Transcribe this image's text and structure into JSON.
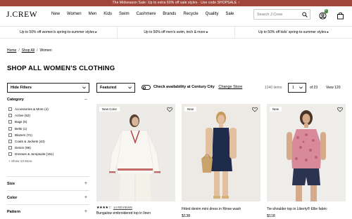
{
  "promo": {
    "text": "The Midseason Sale: Up to extra 60% off sale styles · Use code SHOPSALE",
    "arrow": "↑"
  },
  "brand": {
    "logo": "J.CREW"
  },
  "nav": {
    "links": [
      "New",
      "Women",
      "Men",
      "Kids",
      "Swim",
      "Cashmere",
      "Brands",
      "Recycle",
      "Quality",
      "Sale"
    ],
    "search_placeholder": "Search J.Crew",
    "account_badge_count": "0"
  },
  "benefits": [
    "Up to 50% off women's spring-to-summer styles ▸",
    "Up to 50% off men's swim, tech & more ▸",
    "Up to 50% off kids' spring-to-summer styles ▸"
  ],
  "breadcrumb": {
    "home": "Home",
    "shop_all": "Shop All",
    "current": "Women",
    "separator": "/"
  },
  "page_title": "SHOP ALL WOMEN'S CLOTHING",
  "toolbar": {
    "hide_filters": "Hide Filters",
    "sort_label": "Featured",
    "availability_prefix": "Check availability at ",
    "store_name": "Century City",
    "change_store": "Change Store",
    "item_count": "1340 items",
    "current_page": "1",
    "page_of": "of 23",
    "view_label": "View 120"
  },
  "filters": {
    "category_title": "Category",
    "categories": [
      "Accessories & More (4)",
      "Active (52)",
      "Bags (5)",
      "Belts (1)",
      "Blazers (71)",
      "Coats & Jackets (43)",
      "Denim (98)",
      "Dresses & Jumpsuits (151)"
    ],
    "show_more": "+ Show 13 More",
    "sections": [
      "Size",
      "Color",
      "Pattern"
    ],
    "expand_sign": "+",
    "collapse_sign": "−"
  },
  "products": [
    {
      "tag": "New Color",
      "rating_stars": "★★★★☆",
      "reviews": "14 REVIEWS",
      "name": "Bungalow embroidered top in linen",
      "price": ""
    },
    {
      "tag": "New",
      "rating_stars": "",
      "reviews": "",
      "name": "Fitted denim mini dress in Rinse wash",
      "price": "$138"
    },
    {
      "tag": "New",
      "rating_stars": "",
      "reviews": "",
      "name": "Tie-shoulder top in Liberty® Ellie fabric",
      "price": "$118"
    }
  ],
  "colors": {
    "promo_bg": "#a0463a",
    "badge": "#2e8a3e"
  }
}
